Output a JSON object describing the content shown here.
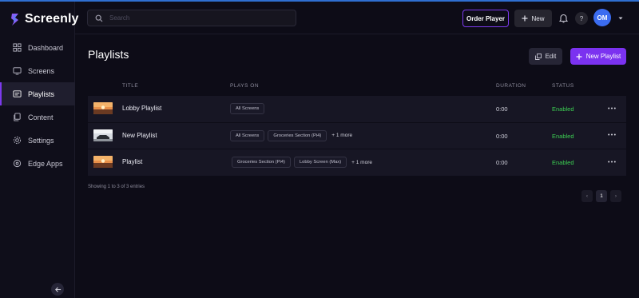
{
  "app": {
    "name": "Screenly"
  },
  "sidebar": {
    "items": [
      {
        "label": "Dashboard",
        "icon": "dashboard-icon",
        "active": false
      },
      {
        "label": "Screens",
        "icon": "monitor-icon",
        "active": false
      },
      {
        "label": "Playlists",
        "icon": "playlist-icon",
        "active": true
      },
      {
        "label": "Content",
        "icon": "files-icon",
        "active": false
      },
      {
        "label": "Settings",
        "icon": "gear-icon",
        "active": false
      },
      {
        "label": "Edge Apps",
        "icon": "edge-apps-icon",
        "active": false
      }
    ],
    "collapse_icon": "arrow-left-icon"
  },
  "header": {
    "search": {
      "placeholder": "Search",
      "value": ""
    },
    "order_player_label": "Order Player",
    "new_label": "New",
    "help_label": "?",
    "avatar_initials": "OM"
  },
  "main": {
    "title": "Playlists",
    "edit_label": "Edit",
    "new_playlist_label": "New Playlist",
    "table": {
      "columns": [
        "TITLE",
        "PLAYS ON",
        "DURATION",
        "STATUS"
      ],
      "rows": [
        {
          "thumb": "sunset-beach",
          "title": "Lobby Playlist",
          "tags": [
            "All Screens"
          ],
          "more": "",
          "duration": "0:00",
          "status": "Enabled"
        },
        {
          "thumb": "car-screen",
          "title": "New Playlist",
          "tags": [
            "All Screens",
            "Groceries Section (Pi4)"
          ],
          "more": "+ 1 more",
          "duration": "0:00",
          "status": "Enabled"
        },
        {
          "thumb": "sunset-beach",
          "title": "Playlist",
          "tags": [
            "Groceries Section (Pi4)",
            "Lobby Screen (Max)"
          ],
          "more": "+ 1 more",
          "duration": "0:00",
          "status": "Enabled"
        }
      ]
    },
    "entries_info": "Showing 1 to 3 of 3 entries",
    "pagination": {
      "prev": "‹",
      "current": "1",
      "next": "›"
    }
  },
  "colors": {
    "accent": "#7b32f0",
    "status_enabled": "#3ccf52",
    "avatar": "#3b6cf0",
    "top_line": "#2f6fd1"
  }
}
